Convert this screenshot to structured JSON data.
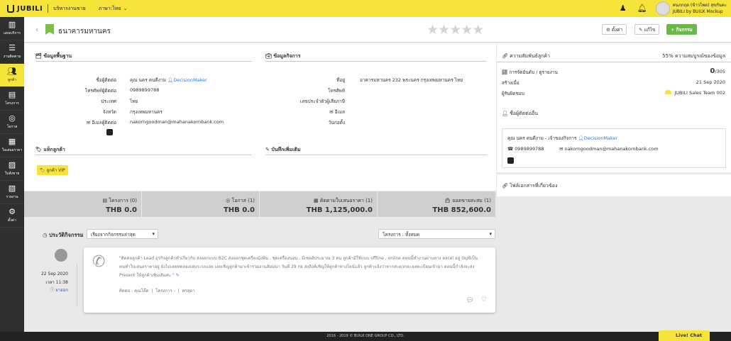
{
  "topbar": {
    "brand": "JUBILI",
    "section": "บริหารงานขาย",
    "language": "ภาษา:ไทย",
    "user_name": "คนภกฤต (ข้าวโพด) สุขกันตะ",
    "user_org": "JUBILI by BUILK Mockup"
  },
  "sidebar": [
    {
      "label": "แผนบริการ",
      "icon": "chart-icon"
    },
    {
      "label": "งานติดตาม",
      "icon": "tasks-icon"
    },
    {
      "label": "ลูกค้า",
      "icon": "users-icon"
    },
    {
      "label": "โครงการ",
      "icon": "doc-icon"
    },
    {
      "label": "โอกาส",
      "icon": "target-icon"
    },
    {
      "label": "ใบเสนอราคา",
      "icon": "list-icon"
    },
    {
      "label": "ใบสั่งขาย",
      "icon": "order-icon"
    },
    {
      "label": "รายงาน",
      "icon": "report-icon"
    },
    {
      "label": "ตั้งค่า",
      "icon": "gear-icon"
    }
  ],
  "header": {
    "title": "ธนาคารมหานคร",
    "btn_settings": "⚙ ตั้งค่า",
    "btn_edit": "✎ แก้ไข",
    "btn_activity": "+ กิจกรรม"
  },
  "basic": {
    "title": "ข้อมูลพื้นฐาน",
    "rows": [
      {
        "label": "ชื่อผู้ติดต่อ",
        "value": "คุณ นคร คนดีงาม",
        "extra": "DecisionMaker"
      },
      {
        "label": "โทรศัพท์ผู้ติดต่อ",
        "value": "0989899788"
      },
      {
        "label": "ประเทศ",
        "value": "ไทย"
      },
      {
        "label": "จังหวัด",
        "value": "กรุงเทพมหานคร"
      },
      {
        "label": "✉ อีเมลผู้ติดต่อ",
        "value": "nakorngoodman@mahanakornbank.com"
      }
    ]
  },
  "business": {
    "title": "ข้อมูลกิจการ",
    "rows": [
      {
        "label": "ที่อยู่",
        "value": "อาคารมหานคร 232 พระนคร กรุงเทพมหานคร ไทย"
      },
      {
        "label": "โทรศัพท์",
        "value": ""
      },
      {
        "label": "เลขประจำตัวผู้เสียภาษี",
        "value": ""
      },
      {
        "label": "✉ อีเมล",
        "value": ""
      },
      {
        "label": "วันก่อตั้ง",
        "value": ""
      }
    ]
  },
  "tags": {
    "title": "แท็กลูกค้า",
    "tag": "ลูกค้า VIP"
  },
  "notes": {
    "title": "บันทึกเพิ่มเติม"
  },
  "stats": [
    {
      "label": "โครงการ (0)",
      "value": "THB 0.0"
    },
    {
      "label": "โอกาส (1)",
      "value": "THB 0.0"
    },
    {
      "label": "ติดตามใบเสนอราคา (1)",
      "value": "THB 1,125,000.0"
    },
    {
      "label": "ยอดขายสะสม (1)",
      "value": "THB 852,600.0"
    }
  ],
  "history": {
    "title": "ประวัติกิจกรรม",
    "sort": "เรียงจากกิจกรรมล่าสุด",
    "filter": "โครงการ : ทั้งหมด",
    "date": "22 Sep 2020",
    "time": "เวลา 11:38",
    "status": "ยาออก",
    "text": "\"ติดต่อลูกค้า Lead ธุรกิจลูกค้าทำเกี่ยวกับ ส่งออกแบบ B2C ส่งออกชุดเครื่องมุ้งพ้น , ชุดเครื่องนอน , มีเซลส์ประมาณ 3 คน ลูกค้ามีใช้แบบ offline , online ตอนนี้ทำงานผ่านทาง excel อยู่ บัญชีเป็นคนทำใบเสนอราคาอยู่ ยังไม่เคยทดลองเล่นระบบเลย เลยเชิญลูกค้ามาเข้าร่วมงานสัมมนา วันที่ 29 ก่อ ส่งลิงค์เชิญให้ลูกค้าทางไลน์แล้ว ลูกค้าแจ้งว่าหากสะดวกจะลงทะเบียนเข้ามา ตอนนี้กำลังจะส่ง Present ให้ลูกค้าเพิ่มเติมค่ะ \"",
    "contact": "ติดต่อ : คุณโอ๊ต",
    "project": "โครงการ -",
    "extra": "พรสุดา"
  },
  "relation": {
    "title": "ความสัมพันธ์ลูกค้า",
    "completeness": "55% ความสมบูรณ์ของข้อมูล",
    "rank_label": "การจัดอันดับ / ดูรายงาน",
    "rank_value": "0",
    "rank_total": "/305",
    "created_label": "สร้างเมื่อ",
    "created_value": "21 Sep 2020",
    "owner_label": "ผู้รับผิดชอบ",
    "owner_value": "JUBILI Sales Team 002"
  },
  "other_contacts": {
    "title": "ชื่อผู้ติดต่ออื่น",
    "name": "คุณ นคร คนดีงาม - เจ้าของกิจการ",
    "role": "DecisionMaker",
    "phone": "0989899788",
    "email": "nakorngoodman@mahanakornbank.com"
  },
  "files": {
    "title": "ไฟล์เอกสารที่เกี่ยวข้อง"
  },
  "footer": "2016 - 2019 © BUILK ONE GROUP CO., LTD.",
  "livechat": "Live! Chat"
}
